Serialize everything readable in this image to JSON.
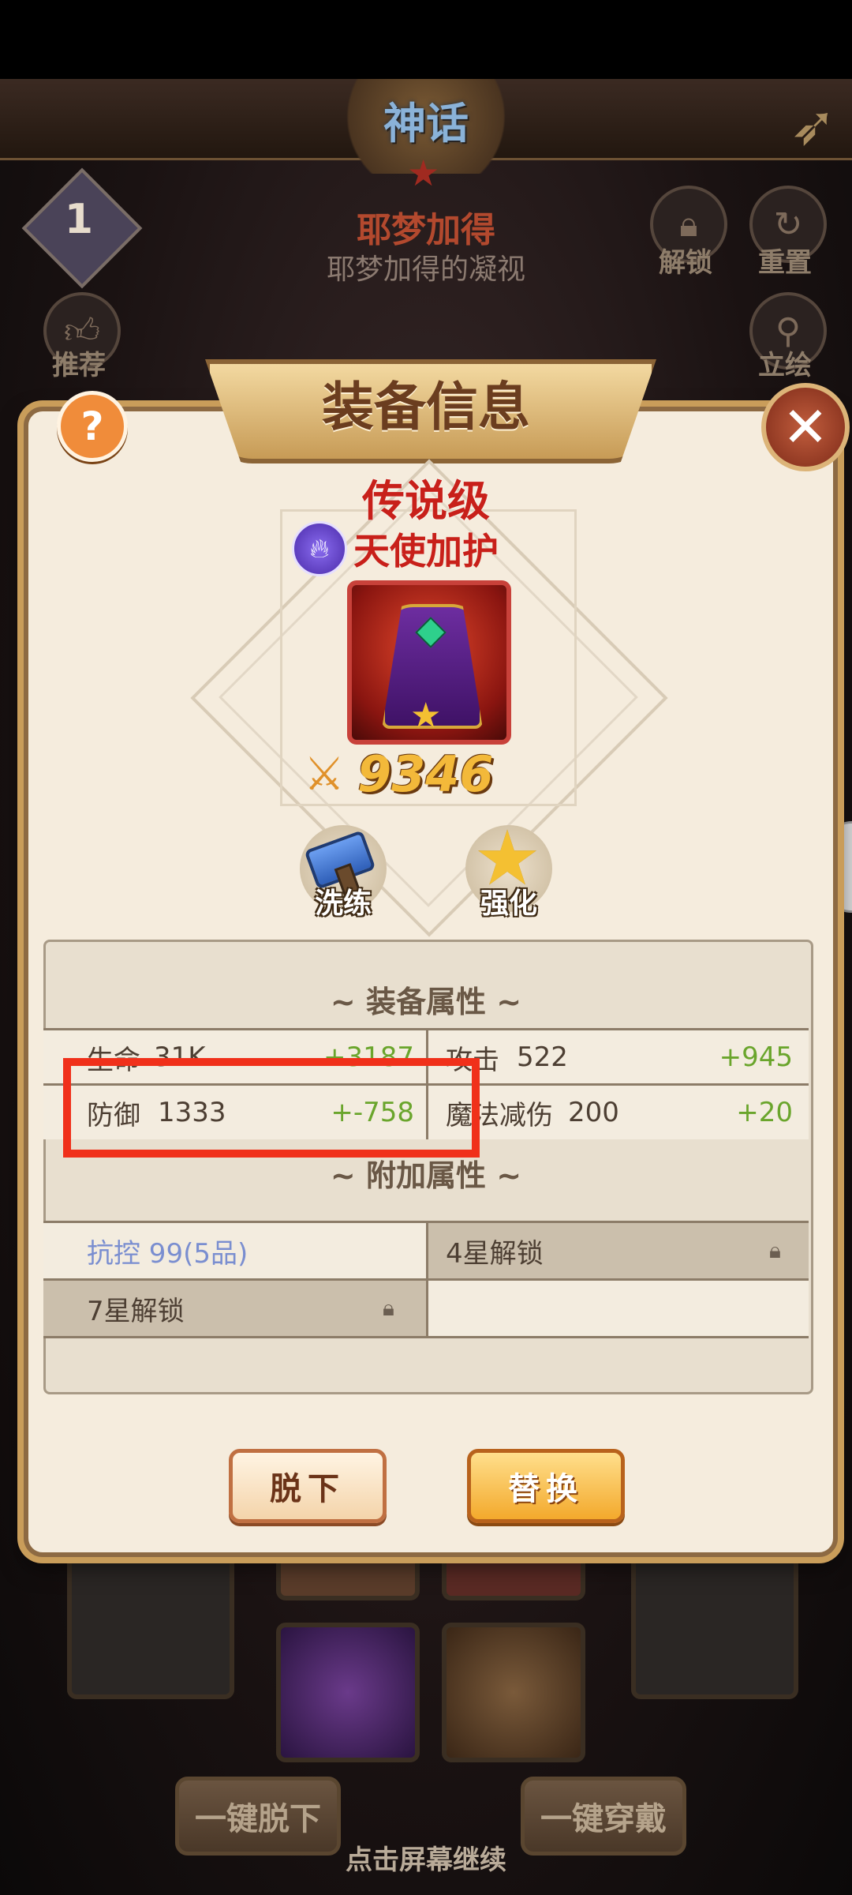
{
  "header": {
    "emblem_title": "神话"
  },
  "character": {
    "name": "耶梦加得",
    "subtitle": "耶梦加得的凝视",
    "level": "1"
  },
  "side_buttons": {
    "unlock": "解锁",
    "reset": "重置",
    "recommend": "推荐",
    "portrait": "立绘"
  },
  "modal": {
    "title": "装备信息",
    "rarity": "传说级",
    "skill_name": "天使加护",
    "power": "9346",
    "actions": {
      "refine": "洗练",
      "enhance": "强化"
    },
    "equip_attrs_title": "装备属性",
    "equip_attrs": [
      {
        "name": "生命",
        "value": "31K",
        "bonus": "+3187"
      },
      {
        "name": "攻击",
        "value": "522",
        "bonus": "+945"
      },
      {
        "name": "防御",
        "value": "1333",
        "bonus": "+-758"
      },
      {
        "name": "魔法减伤",
        "value": "200",
        "bonus": "+20"
      }
    ],
    "extra_attrs_title": "附加属性",
    "extra_attrs": [
      {
        "text": "抗控  99(5品)",
        "locked": false
      },
      {
        "text": "4星解锁",
        "locked": true
      },
      {
        "text": "7星解锁",
        "locked": true
      }
    ],
    "buttons": {
      "take_off": "脱下",
      "replace": "替换"
    }
  },
  "bottom": {
    "unequip_all": "一键脱下",
    "equip_all": "一键穿戴",
    "tap_continue": "点击屏幕继续"
  },
  "colors": {
    "rarity_red": "#c8201a",
    "bonus_green": "#6aa52c",
    "highlight_red": "#f0301a",
    "accent_gold": "#f3b93a"
  }
}
